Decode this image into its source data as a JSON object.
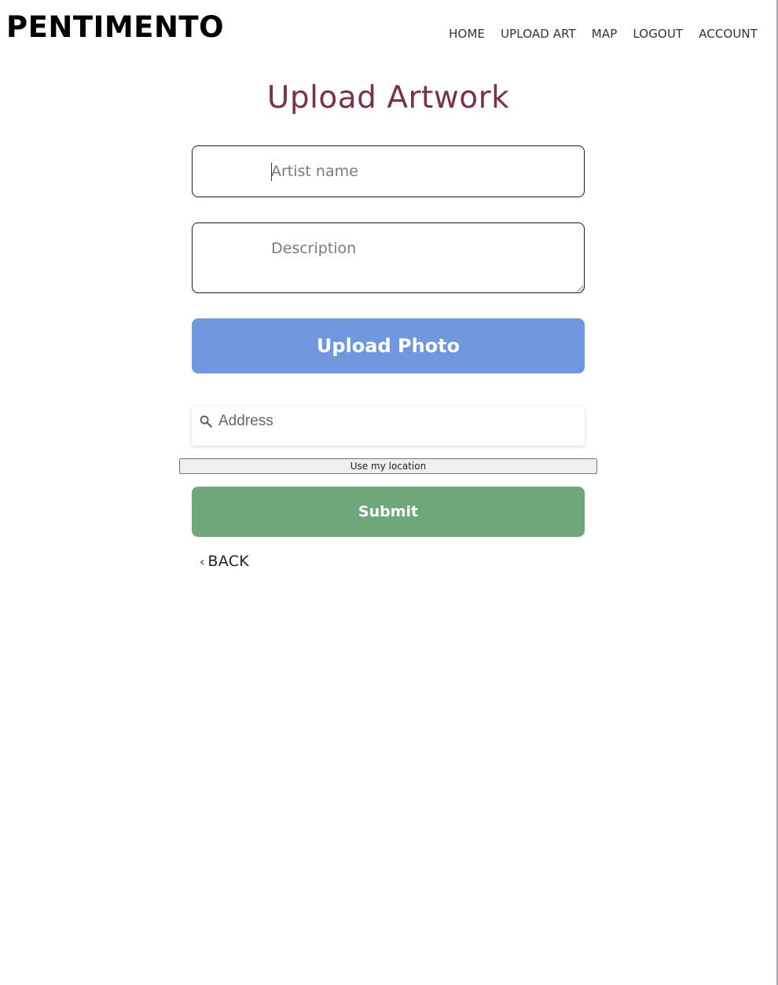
{
  "header": {
    "logo": "PENTIMENTO",
    "nav": [
      {
        "label": "HOME"
      },
      {
        "label": "UPLOAD ART"
      },
      {
        "label": "MAP"
      },
      {
        "label": "LOGOUT"
      },
      {
        "label": "ACCOUNT"
      }
    ]
  },
  "main": {
    "title": "Upload Artwork",
    "artist_field": {
      "placeholder": "Artist name",
      "value": ""
    },
    "description_field": {
      "placeholder": "Description",
      "value": ""
    },
    "upload_photo_label": "Upload Photo",
    "address": {
      "placeholder": "Address",
      "icon": "search-icon"
    },
    "use_location_label": "Use my location",
    "submit_label": "Submit",
    "back": {
      "icon": "‹",
      "label": "BACK"
    }
  },
  "colors": {
    "title": "#7a3245",
    "upload_button": "#6f97dd",
    "submit_button": "#70a77a"
  }
}
